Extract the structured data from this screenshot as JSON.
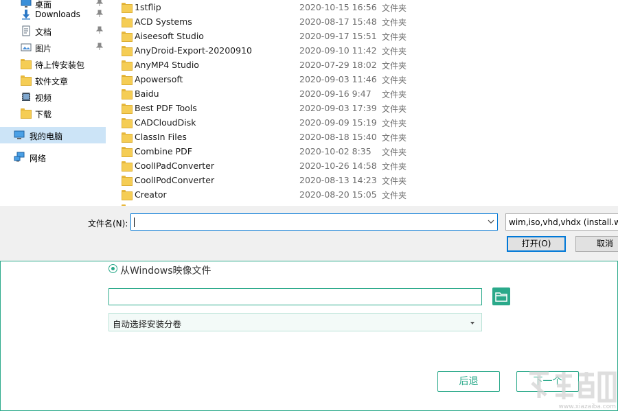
{
  "nav": {
    "items": [
      {
        "label": "桌面",
        "icon": "desktop-icon",
        "pinned": true
      },
      {
        "label": "Downloads",
        "icon": "download-arrow-icon",
        "pinned": true
      },
      {
        "label": "文档",
        "icon": "document-icon",
        "pinned": true
      },
      {
        "label": "图片",
        "icon": "picture-icon",
        "pinned": true
      },
      {
        "label": "待上传安装包",
        "icon": "folder-icon",
        "pinned": false
      },
      {
        "label": "软件文章",
        "icon": "folder-icon",
        "pinned": false
      },
      {
        "label": "视频",
        "icon": "video-icon",
        "pinned": false
      },
      {
        "label": "下载",
        "icon": "folder-icon",
        "pinned": false
      }
    ],
    "this_pc": "我的电脑",
    "network": "网络"
  },
  "files": [
    {
      "name": "1stflip",
      "date": "2020-10-15 16:56",
      "type": "文件夹"
    },
    {
      "name": "ACD Systems",
      "date": "2020-08-17 15:48",
      "type": "文件夹"
    },
    {
      "name": "Aiseesoft Studio",
      "date": "2020-09-17 15:51",
      "type": "文件夹"
    },
    {
      "name": "AnyDroid-Export-20200910",
      "date": "2020-09-10 11:42",
      "type": "文件夹"
    },
    {
      "name": "AnyMP4 Studio",
      "date": "2020-07-29 18:02",
      "type": "文件夹"
    },
    {
      "name": "Apowersoft",
      "date": "2020-09-03 11:46",
      "type": "文件夹"
    },
    {
      "name": "Baidu",
      "date": "2020-09-16 9:47",
      "type": "文件夹"
    },
    {
      "name": "Best PDF Tools",
      "date": "2020-09-03 17:39",
      "type": "文件夹"
    },
    {
      "name": "CADCloudDisk",
      "date": "2020-09-09 15:19",
      "type": "文件夹"
    },
    {
      "name": "ClassIn Files",
      "date": "2020-08-18 15:40",
      "type": "文件夹"
    },
    {
      "name": "Combine PDF",
      "date": "2020-10-02 8:35",
      "type": "文件夹"
    },
    {
      "name": "CoolIPadConverter",
      "date": "2020-10-26 14:58",
      "type": "文件夹"
    },
    {
      "name": "CoolIPodConverter",
      "date": "2020-08-13 14:23",
      "type": "文件夹"
    },
    {
      "name": "Creator",
      "date": "2020-08-20 15:05",
      "type": "文件夹"
    }
  ],
  "bottom_bar": {
    "filename_label": "文件名(N):",
    "filename_value": "",
    "filetype": "wim,iso,vhd,vhdx (install.wim",
    "open_label": "打开(O)",
    "cancel_label": "取消"
  },
  "installer": {
    "radio_label": "从Windows映像文件",
    "radio_selected": true,
    "image_path": "",
    "volume_select": "自动选择安装分卷",
    "back_label": "后退",
    "next_label": "下一个",
    "accent_color": "#2aa98a"
  },
  "watermark": {
    "url": "www.xiazaiba.com"
  }
}
